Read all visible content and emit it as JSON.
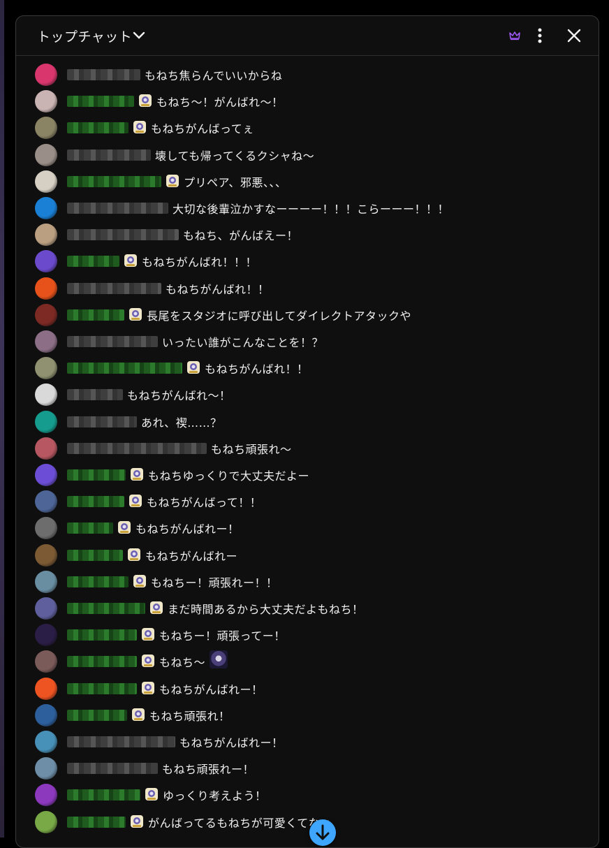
{
  "header": {
    "title": "トップチャット",
    "dropdown_icon": "chevron-down-icon",
    "crown_icon": "crown-icon",
    "menu_icon": "kebab-menu-icon",
    "close_icon": "close-icon"
  },
  "colors": {
    "background": "#0f0f0f",
    "text": "#f1f1f1",
    "member_name": "#2ba640",
    "accent_blue": "#3ea6ff",
    "crown": "#a35cff"
  },
  "messages": [
    {
      "text": "もねち焦らんでいいからね",
      "member": false,
      "badge": false
    },
    {
      "text": "もねち〜！がんばれ〜！",
      "member": true,
      "badge": true
    },
    {
      "text": "もねちがんばってぇ",
      "member": true,
      "badge": true
    },
    {
      "text": "壊しても帰ってくるクシャね〜",
      "member": false,
      "badge": false
    },
    {
      "text": "プリペア、邪悪、、、",
      "member": true,
      "badge": true
    },
    {
      "text": "大切な後輩泣かすなーーーー！！！こらーーー！！！",
      "member": false,
      "badge": false
    },
    {
      "text": "もねち、がんばえー！",
      "member": false,
      "badge": false
    },
    {
      "text": "もねちがんばれ！！！",
      "member": true,
      "badge": true
    },
    {
      "text": "もねちがんばれ！！",
      "member": false,
      "badge": false
    },
    {
      "text": "長尾をスタジオに呼び出してダイレクトアタックや",
      "member": true,
      "badge": true
    },
    {
      "text": "いったい誰がこんなことを！？",
      "member": false,
      "badge": false
    },
    {
      "text": "もねちがんばれ！！",
      "member": true,
      "badge": true
    },
    {
      "text": "もねちがんばれ〜！",
      "member": false,
      "badge": false
    },
    {
      "text": "あれ、禊……？",
      "member": false,
      "badge": false
    },
    {
      "text": "もねち頑張れ〜",
      "member": false,
      "badge": false
    },
    {
      "text": "もねちゆっくりで大丈夫だよー",
      "member": true,
      "badge": true
    },
    {
      "text": "もねちがんばって！！",
      "member": true,
      "badge": true
    },
    {
      "text": "もねちがんばれー！",
      "member": true,
      "badge": true
    },
    {
      "text": "もねちがんばれー",
      "member": true,
      "badge": true
    },
    {
      "text": "もねちー！頑張れー！！",
      "member": true,
      "badge": true
    },
    {
      "text": "まだ時間あるから大丈夫だよもねち！",
      "member": true,
      "badge": true
    },
    {
      "text": "もねちー！頑張ってー！",
      "member": true,
      "badge": true
    },
    {
      "text": "もねち〜",
      "member": true,
      "badge": true,
      "emote": "character-emote"
    },
    {
      "text": "もねちがんばれー！",
      "member": true,
      "badge": true
    },
    {
      "text": "もねち頑張れ！",
      "member": true,
      "badge": true
    },
    {
      "text": "もねちがんばれー！",
      "member": false,
      "badge": false
    },
    {
      "text": "もねち頑張れー！",
      "member": false,
      "badge": false
    },
    {
      "text": "ゆっくり考えよう！",
      "member": true,
      "badge": true
    },
    {
      "text": "がんばってるもねちが可愛くてなぁ",
      "member": true,
      "badge": true
    }
  ],
  "scroll_button_icon": "arrow-down-icon"
}
